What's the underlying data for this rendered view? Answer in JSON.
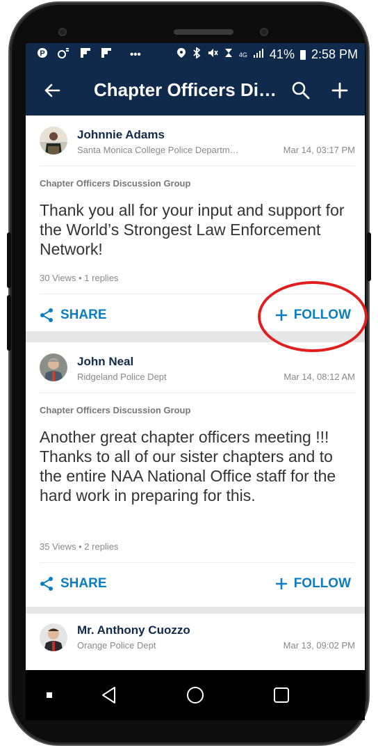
{
  "status_bar": {
    "battery": "41%",
    "time": "2:58 PM",
    "network": "4G",
    "icons": [
      "pinterest-icon",
      "sound-icon",
      "flipboard-icon",
      "flipboard-icon",
      "more-dots-icon",
      "location-icon",
      "bluetooth-icon",
      "mute-icon",
      "alarm-icon",
      "signal-icon",
      "battery-icon"
    ]
  },
  "app_bar": {
    "title": "Chapter Officers Di…",
    "back_icon": "back-arrow-icon",
    "search_icon": "search-icon",
    "add_icon": "plus-icon",
    "background": "#0f2a4a"
  },
  "posts": [
    {
      "author": "Johnnie Adams",
      "department": "Santa Monica College Police Departm…",
      "date": "Mar 14, 03:17 PM",
      "group": "Chapter Officers Discussion Group",
      "body": "Thank you all for your input and support for the World’s Strongest Law Enforcement Network!",
      "stats": "30 Views • 1 replies",
      "share_label": "SHARE",
      "follow_label": "FOLLOW"
    },
    {
      "author": "John Neal",
      "department": "Ridgeland Police Dept",
      "date": "Mar 14, 08:12 AM",
      "group": "Chapter Officers Discussion Group",
      "body": "Another great chapter officers meeting !!!  Thanks to all of our sister chapters and to the entire NAA National Office staff for the hard work in preparing for this.",
      "stats": "35 Views • 2 replies",
      "share_label": "SHARE",
      "follow_label": "FOLLOW"
    },
    {
      "author": "Mr. Anthony Cuozzo",
      "department": "Orange Police Dept",
      "date": "Mar 13, 09:02 PM"
    }
  ],
  "colors": {
    "accent": "#0a7ec2",
    "author": "#0f2a4a",
    "highlight_ring": "#e11d1d"
  },
  "nav_bar": {
    "icons": [
      "recent-apps-icon",
      "back-triangle-icon",
      "home-circle-icon",
      "overview-square-icon"
    ]
  }
}
